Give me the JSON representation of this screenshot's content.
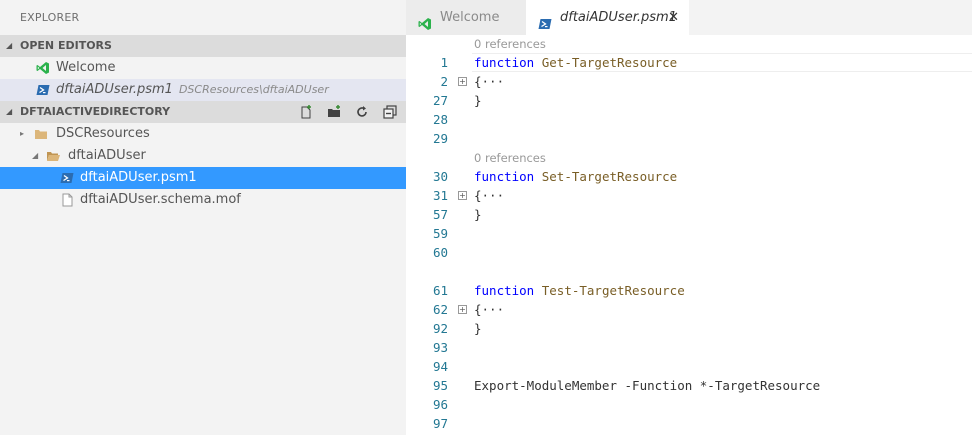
{
  "sidebar": {
    "explorer_title": "EXPLORER",
    "open_editors_header": "OPEN EDITORS",
    "open_editors": [
      {
        "label": "Welcome",
        "desc": "",
        "icon": "vscode-icon"
      },
      {
        "label": "dftaiADUser.psm1",
        "desc": "DSCResources\\dftaiADUser",
        "icon": "powershell-icon"
      }
    ],
    "project_header": "DFTAIACTIVEDIRECTORY",
    "toolbar_icons": [
      "new-file-icon",
      "new-folder-icon",
      "refresh-icon",
      "collapse-all-icon"
    ],
    "tree": [
      {
        "label": "DSCResources",
        "type": "folder"
      },
      {
        "label": "dftaiADUser",
        "type": "folder"
      },
      {
        "label": "dftaiADUser.psm1",
        "type": "powershell"
      },
      {
        "label": "dftaiADUser.schema.mof",
        "type": "file"
      }
    ]
  },
  "tabs": [
    {
      "label": "Welcome",
      "active": false
    },
    {
      "label": "dftaiADUser.psm1",
      "active": true,
      "close": "✕"
    }
  ],
  "code": {
    "codelens": [
      "0 references",
      "0 references"
    ],
    "lines": [
      {
        "ln": "1",
        "kw": "function",
        "rest": " Get-TargetResource"
      },
      {
        "ln": "2",
        "fold": "+",
        "text": "{···"
      },
      {
        "ln": "27",
        "text": "}"
      },
      {
        "ln": "28",
        "text": ""
      },
      {
        "ln": "29",
        "text": ""
      },
      {
        "ln": "30",
        "kw": "function",
        "rest": " Set-TargetResource"
      },
      {
        "ln": "31",
        "fold": "+",
        "text": "{···"
      },
      {
        "ln": "57",
        "text": "}"
      },
      {
        "ln": "59",
        "text": ""
      },
      {
        "ln": "60",
        "text": ""
      },
      {
        "ln": "61",
        "kw": "function",
        "rest": " Test-TargetResource"
      },
      {
        "ln": "62",
        "fold": "+",
        "text": "{···"
      },
      {
        "ln": "92",
        "text": "}"
      },
      {
        "ln": "93",
        "text": ""
      },
      {
        "ln": "94",
        "text": ""
      },
      {
        "ln": "95",
        "text": "Export-ModuleMember -Function *-TargetResource"
      },
      {
        "ln": "96",
        "text": ""
      },
      {
        "ln": "97",
        "text": ""
      }
    ]
  },
  "colors": {
    "accent_selection": "#3399ff",
    "line_number": "#237893",
    "keyword": "#0000ff",
    "function_name": "#795e26"
  }
}
